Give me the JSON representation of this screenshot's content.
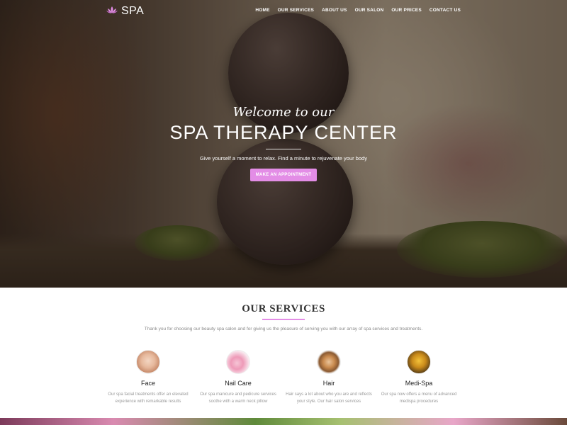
{
  "nav": {
    "logo_text": "SPA",
    "logo_icon": "lotus-icon",
    "items": [
      {
        "label": "HOME"
      },
      {
        "label": "OUR SERVICES"
      },
      {
        "label": "ABOUT US"
      },
      {
        "label": "OUR SALON"
      },
      {
        "label": "OUR PRICES"
      },
      {
        "label": "CONTACT US"
      }
    ]
  },
  "hero": {
    "welcome": "Welcome to our",
    "title": "SPA THERAPY CENTER",
    "subtitle": "Give yourself a moment to relax. Find a minute to rejuvenate your body",
    "cta_label": "MAKE AN APPOINTMENT"
  },
  "services": {
    "title": "OUR SERVICES",
    "intro": "Thank you for choosing our beauty spa salon and for giving us the pleasure of serving you with our array of spa services and treatments.",
    "items": [
      {
        "name": "Face",
        "description_line1": "Our spa facial treatments offer an elevated",
        "description_line2": "experience with remarkable results"
      },
      {
        "name": "Nail Care",
        "description_line1": "Our spa manicure and pedicure services",
        "description_line2": "soothe with a warm neck pillow"
      },
      {
        "name": "Hair",
        "description_line1": "Hair says a lot about who you are and reflects",
        "description_line2": "your style. Our hair salon services"
      },
      {
        "name": "Medi-Spa",
        "description_line1": "Our spa now offers a menu of advanced",
        "description_line2": "medispa procedures"
      }
    ]
  },
  "colors": {
    "accent": "#e38de6",
    "heading": "#333333",
    "muted_text": "#999999"
  }
}
